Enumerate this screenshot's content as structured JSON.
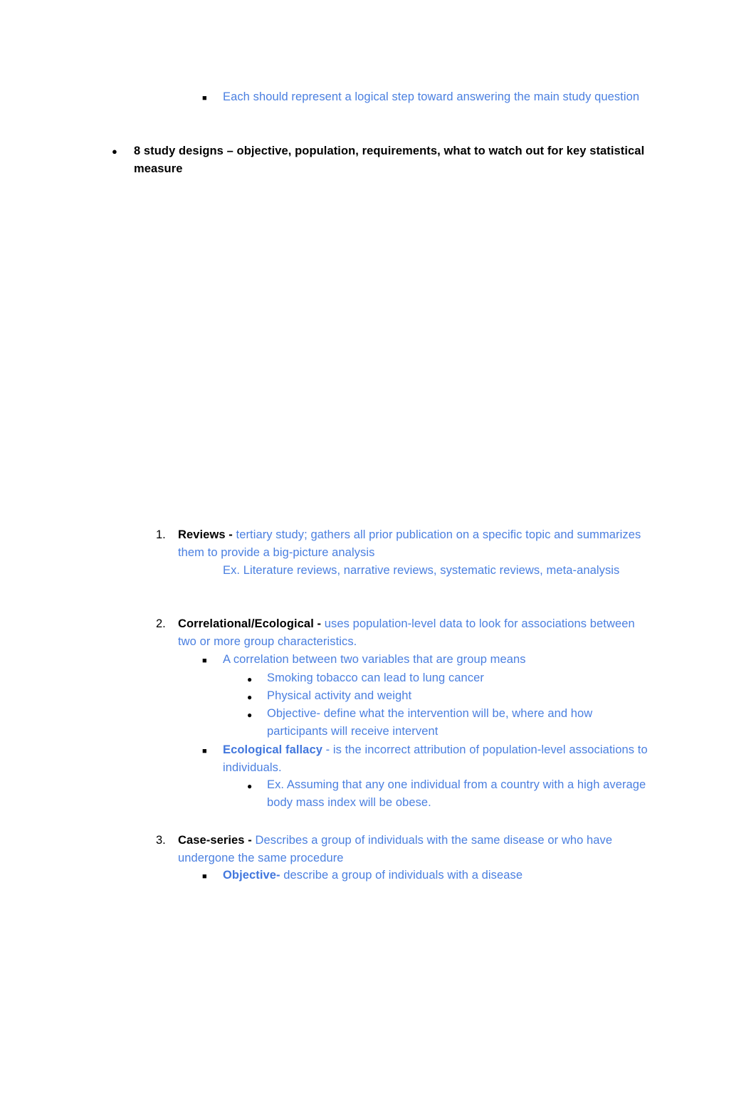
{
  "document": {
    "type": "study-notes",
    "colors": {
      "body_text_blue": "#4a7fe0",
      "heading_black": "#000000",
      "bold_blue_accent": "#4277dd",
      "page_background": "#ffffff"
    },
    "bullet_glyphs": {
      "level1_disc": "●",
      "level2_square": "■",
      "level3_disc": "●",
      "ordered": "decimal"
    }
  },
  "content": {
    "top_subbullet": {
      "marker": "■",
      "text": "Each should represent a logical step toward answering the main study question"
    },
    "main_heading": {
      "marker": "●",
      "text": "8 study designs – objective, population, requirements, what to watch out for key statistical measure"
    },
    "items": [
      {
        "number": "1.",
        "term": "Reviews - ",
        "definition": "tertiary study; gathers all prior publication on a specific topic and summarizes them to provide a big-picture analysis",
        "plain_subline": "Ex. Literature reviews, narrative reviews, systematic reviews, meta-analysis"
      },
      {
        "number": "2.",
        "term": "Correlational/Ecological - ",
        "definition": "uses population-level data to look for associations between two or more group characteristics.",
        "sub_a": {
          "marker": "■",
          "text": "A correlation between two variables that are group means",
          "children": [
            {
              "marker": "●",
              "text": "Smoking tobacco can lead to lung cancer"
            },
            {
              "marker": "●",
              "text": "Physical activity and weight"
            },
            {
              "marker": "●",
              "text": "Objective- define what the intervention will be, where and how participants will receive intervent"
            }
          ]
        },
        "sub_b": {
          "marker": "■",
          "term": "Ecological fallacy",
          "definition": " - is the incorrect attribution of population-level associations to individuals.",
          "children": [
            {
              "marker": "●",
              "text": "Ex. Assuming that any one individual from a country with a high average body mass index will be obese."
            }
          ]
        }
      },
      {
        "number": "3.",
        "term": "Case-series - ",
        "definition": "Describes a group of individuals with the same disease or who have undergone the same procedure",
        "sub_a": {
          "marker": "■",
          "term": "Objective-",
          "definition": " describe a group of individuals with a disease"
        }
      }
    ]
  }
}
